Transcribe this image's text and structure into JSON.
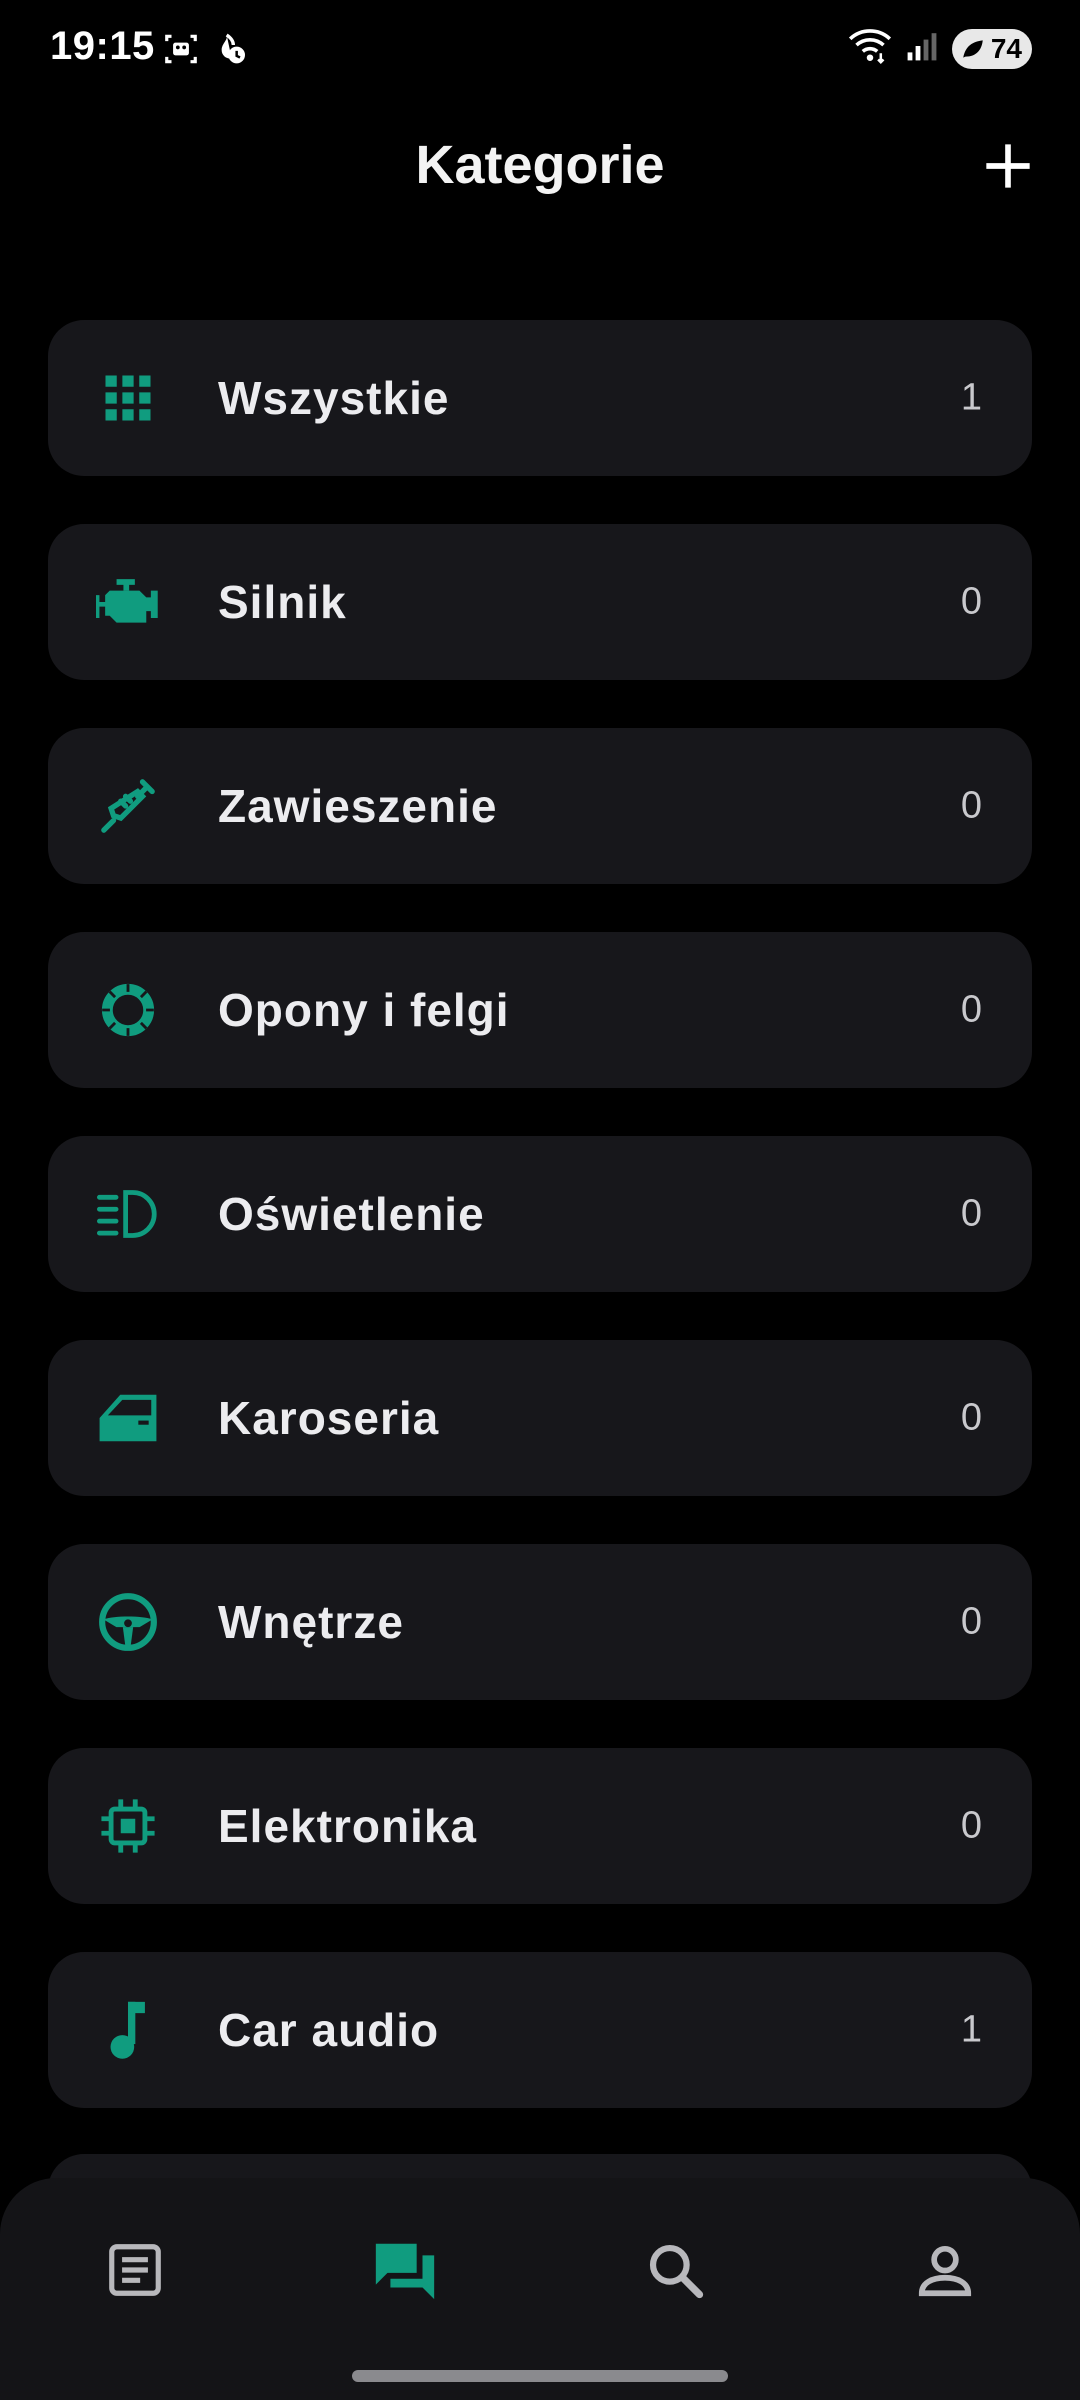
{
  "status_bar": {
    "time": "19:15",
    "battery": "74"
  },
  "header": {
    "title": "Kategorie"
  },
  "categories": [
    {
      "label": "Wszystkie",
      "count": "1",
      "icon": "grid-icon"
    },
    {
      "label": "Silnik",
      "count": "0",
      "icon": "engine-icon"
    },
    {
      "label": "Zawieszenie",
      "count": "0",
      "icon": "syringe-icon"
    },
    {
      "label": "Opony i felgi",
      "count": "0",
      "icon": "tire-icon"
    },
    {
      "label": "Oświetlenie",
      "count": "0",
      "icon": "headlight-icon"
    },
    {
      "label": "Karoseria",
      "count": "0",
      "icon": "car-door-icon"
    },
    {
      "label": "Wnętrze",
      "count": "0",
      "icon": "steering-wheel-icon"
    },
    {
      "label": "Elektronika",
      "count": "0",
      "icon": "chip-icon"
    },
    {
      "label": "Car audio",
      "count": "1",
      "icon": "music-note-icon"
    }
  ],
  "bottom_nav": {
    "items": [
      {
        "icon": "article-icon",
        "active": false
      },
      {
        "icon": "forum-icon",
        "active": true
      },
      {
        "icon": "search-icon",
        "active": false
      },
      {
        "icon": "person-icon",
        "active": false
      }
    ]
  },
  "colors": {
    "accent": "#109c7f",
    "card": "#17171b",
    "background": "#000000",
    "nav_inactive": "#b8b8bc"
  }
}
